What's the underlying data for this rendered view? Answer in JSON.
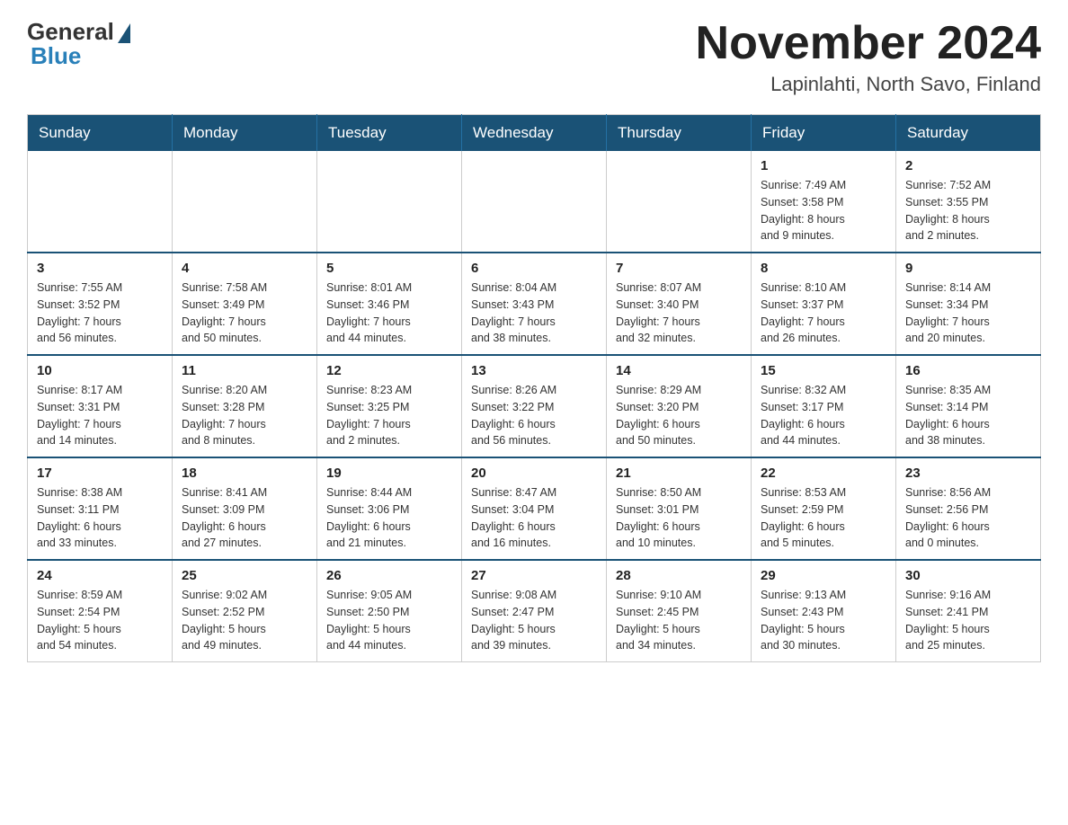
{
  "header": {
    "logo_general": "General",
    "logo_blue": "Blue",
    "month_title": "November 2024",
    "location": "Lapinlahti, North Savo, Finland"
  },
  "weekdays": [
    "Sunday",
    "Monday",
    "Tuesday",
    "Wednesday",
    "Thursday",
    "Friday",
    "Saturday"
  ],
  "weeks": [
    [
      {
        "day": "",
        "info": ""
      },
      {
        "day": "",
        "info": ""
      },
      {
        "day": "",
        "info": ""
      },
      {
        "day": "",
        "info": ""
      },
      {
        "day": "",
        "info": ""
      },
      {
        "day": "1",
        "info": "Sunrise: 7:49 AM\nSunset: 3:58 PM\nDaylight: 8 hours\nand 9 minutes."
      },
      {
        "day": "2",
        "info": "Sunrise: 7:52 AM\nSunset: 3:55 PM\nDaylight: 8 hours\nand 2 minutes."
      }
    ],
    [
      {
        "day": "3",
        "info": "Sunrise: 7:55 AM\nSunset: 3:52 PM\nDaylight: 7 hours\nand 56 minutes."
      },
      {
        "day": "4",
        "info": "Sunrise: 7:58 AM\nSunset: 3:49 PM\nDaylight: 7 hours\nand 50 minutes."
      },
      {
        "day": "5",
        "info": "Sunrise: 8:01 AM\nSunset: 3:46 PM\nDaylight: 7 hours\nand 44 minutes."
      },
      {
        "day": "6",
        "info": "Sunrise: 8:04 AM\nSunset: 3:43 PM\nDaylight: 7 hours\nand 38 minutes."
      },
      {
        "day": "7",
        "info": "Sunrise: 8:07 AM\nSunset: 3:40 PM\nDaylight: 7 hours\nand 32 minutes."
      },
      {
        "day": "8",
        "info": "Sunrise: 8:10 AM\nSunset: 3:37 PM\nDaylight: 7 hours\nand 26 minutes."
      },
      {
        "day": "9",
        "info": "Sunrise: 8:14 AM\nSunset: 3:34 PM\nDaylight: 7 hours\nand 20 minutes."
      }
    ],
    [
      {
        "day": "10",
        "info": "Sunrise: 8:17 AM\nSunset: 3:31 PM\nDaylight: 7 hours\nand 14 minutes."
      },
      {
        "day": "11",
        "info": "Sunrise: 8:20 AM\nSunset: 3:28 PM\nDaylight: 7 hours\nand 8 minutes."
      },
      {
        "day": "12",
        "info": "Sunrise: 8:23 AM\nSunset: 3:25 PM\nDaylight: 7 hours\nand 2 minutes."
      },
      {
        "day": "13",
        "info": "Sunrise: 8:26 AM\nSunset: 3:22 PM\nDaylight: 6 hours\nand 56 minutes."
      },
      {
        "day": "14",
        "info": "Sunrise: 8:29 AM\nSunset: 3:20 PM\nDaylight: 6 hours\nand 50 minutes."
      },
      {
        "day": "15",
        "info": "Sunrise: 8:32 AM\nSunset: 3:17 PM\nDaylight: 6 hours\nand 44 minutes."
      },
      {
        "day": "16",
        "info": "Sunrise: 8:35 AM\nSunset: 3:14 PM\nDaylight: 6 hours\nand 38 minutes."
      }
    ],
    [
      {
        "day": "17",
        "info": "Sunrise: 8:38 AM\nSunset: 3:11 PM\nDaylight: 6 hours\nand 33 minutes."
      },
      {
        "day": "18",
        "info": "Sunrise: 8:41 AM\nSunset: 3:09 PM\nDaylight: 6 hours\nand 27 minutes."
      },
      {
        "day": "19",
        "info": "Sunrise: 8:44 AM\nSunset: 3:06 PM\nDaylight: 6 hours\nand 21 minutes."
      },
      {
        "day": "20",
        "info": "Sunrise: 8:47 AM\nSunset: 3:04 PM\nDaylight: 6 hours\nand 16 minutes."
      },
      {
        "day": "21",
        "info": "Sunrise: 8:50 AM\nSunset: 3:01 PM\nDaylight: 6 hours\nand 10 minutes."
      },
      {
        "day": "22",
        "info": "Sunrise: 8:53 AM\nSunset: 2:59 PM\nDaylight: 6 hours\nand 5 minutes."
      },
      {
        "day": "23",
        "info": "Sunrise: 8:56 AM\nSunset: 2:56 PM\nDaylight: 6 hours\nand 0 minutes."
      }
    ],
    [
      {
        "day": "24",
        "info": "Sunrise: 8:59 AM\nSunset: 2:54 PM\nDaylight: 5 hours\nand 54 minutes."
      },
      {
        "day": "25",
        "info": "Sunrise: 9:02 AM\nSunset: 2:52 PM\nDaylight: 5 hours\nand 49 minutes."
      },
      {
        "day": "26",
        "info": "Sunrise: 9:05 AM\nSunset: 2:50 PM\nDaylight: 5 hours\nand 44 minutes."
      },
      {
        "day": "27",
        "info": "Sunrise: 9:08 AM\nSunset: 2:47 PM\nDaylight: 5 hours\nand 39 minutes."
      },
      {
        "day": "28",
        "info": "Sunrise: 9:10 AM\nSunset: 2:45 PM\nDaylight: 5 hours\nand 34 minutes."
      },
      {
        "day": "29",
        "info": "Sunrise: 9:13 AM\nSunset: 2:43 PM\nDaylight: 5 hours\nand 30 minutes."
      },
      {
        "day": "30",
        "info": "Sunrise: 9:16 AM\nSunset: 2:41 PM\nDaylight: 5 hours\nand 25 minutes."
      }
    ]
  ],
  "colors": {
    "header_bg": "#1a5276",
    "header_text": "#ffffff",
    "border": "#aaaaaa"
  }
}
